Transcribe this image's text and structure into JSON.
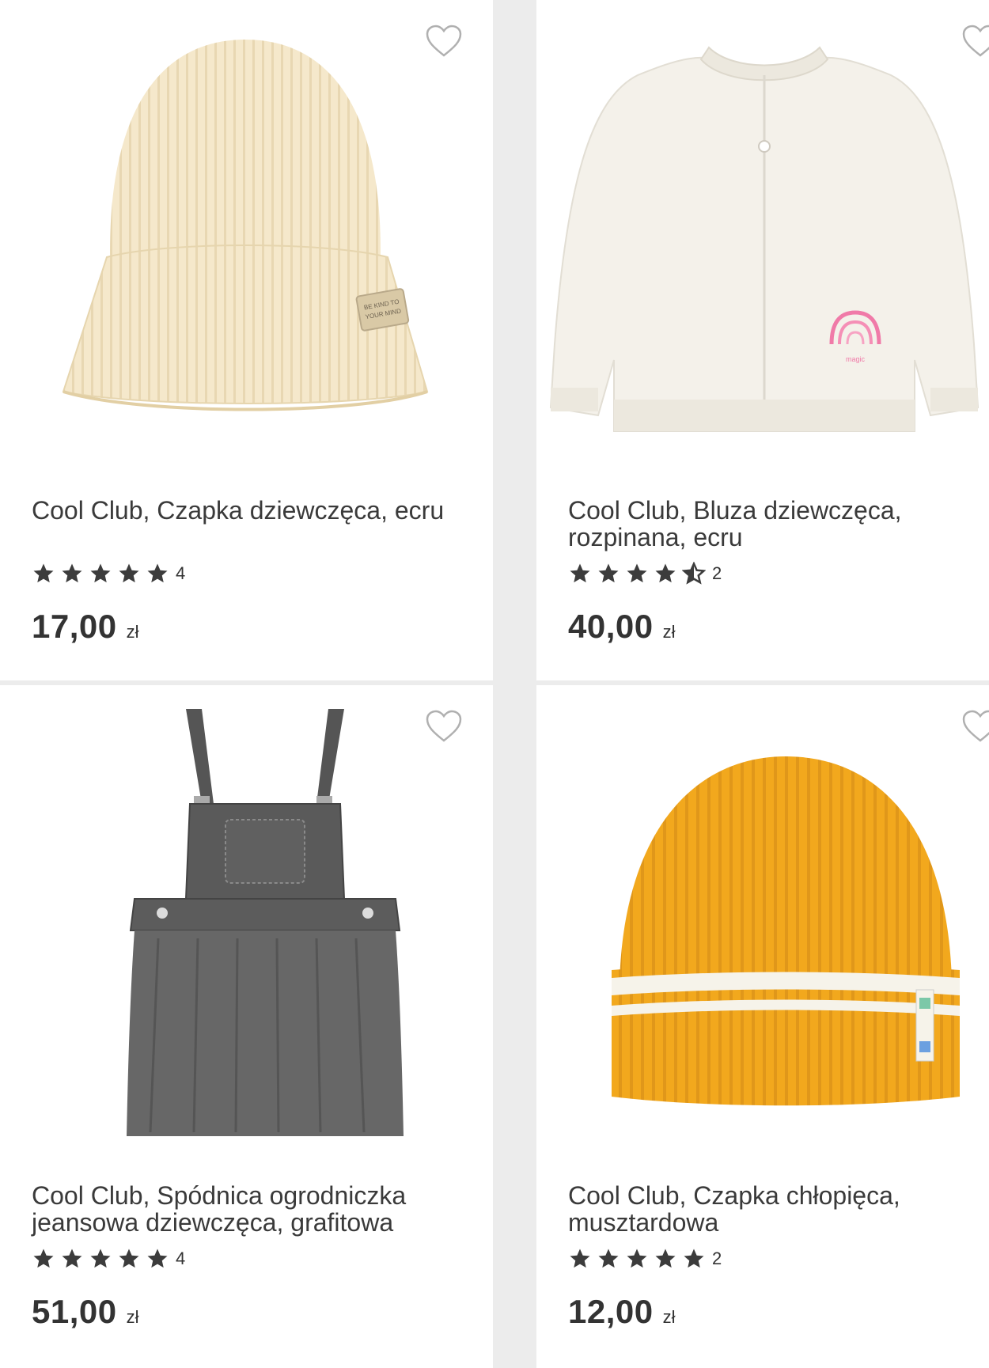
{
  "products": [
    {
      "title": "Cool Club, Czapka dziewczęca, ecru",
      "rating": 5,
      "review_count": "4",
      "price": "17,00",
      "currency": "zł",
      "image": "ecru-knit-beanie",
      "badge_text": "BE KIND TO YOUR MIND"
    },
    {
      "title": "Cool Club, Bluza dziewczęca, rozpinana, ecru",
      "rating": 4.5,
      "review_count": "2",
      "price": "40,00",
      "currency": "zł",
      "image": "ecru-zip-jacket"
    },
    {
      "title": "Cool Club, Spódnica ogrodniczka jeansowa dziewczęca, grafitowa",
      "rating": 5,
      "review_count": "4",
      "price": "51,00",
      "currency": "zł",
      "image": "graphite-denim-pinafore"
    },
    {
      "title": "Cool Club, Czapka chłopięca, musztardowa",
      "rating": 5,
      "review_count": "2",
      "price": "12,00",
      "currency": "zł",
      "image": "mustard-striped-beanie"
    }
  ],
  "icons": {
    "favorite": "heart-outline-icon",
    "star_full": "star-filled-icon",
    "star_half": "star-half-icon"
  },
  "colors": {
    "star": "#3c3c3c",
    "heart_stroke": "#b0b0b0",
    "ecru_hat": "#f5e7c9",
    "mustard_hat": "#f2a81d",
    "denim": "#555555"
  }
}
